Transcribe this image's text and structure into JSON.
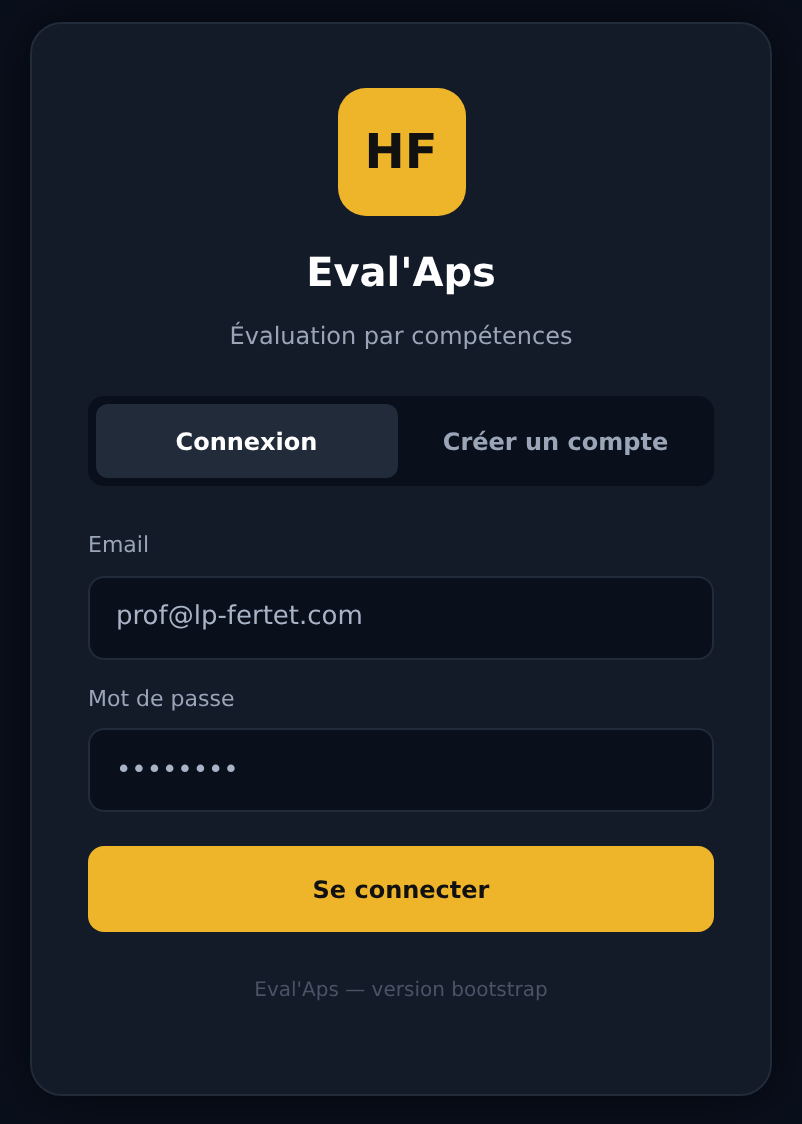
{
  "logo": {
    "text": "HF"
  },
  "title": "Eval'Aps",
  "subtitle": "Évaluation par compétences",
  "tabs": [
    {
      "label": "Connexion",
      "selected": true
    },
    {
      "label": "Créer un compte",
      "selected": false
    }
  ],
  "fields": [
    {
      "label": "Email",
      "value": "prof@lp-fertet.com"
    },
    {
      "label": "Mot de passe",
      "value": "••••••••"
    }
  ],
  "submit": "Se connecter",
  "footer": "Eval'Aps — version bootstrap"
}
